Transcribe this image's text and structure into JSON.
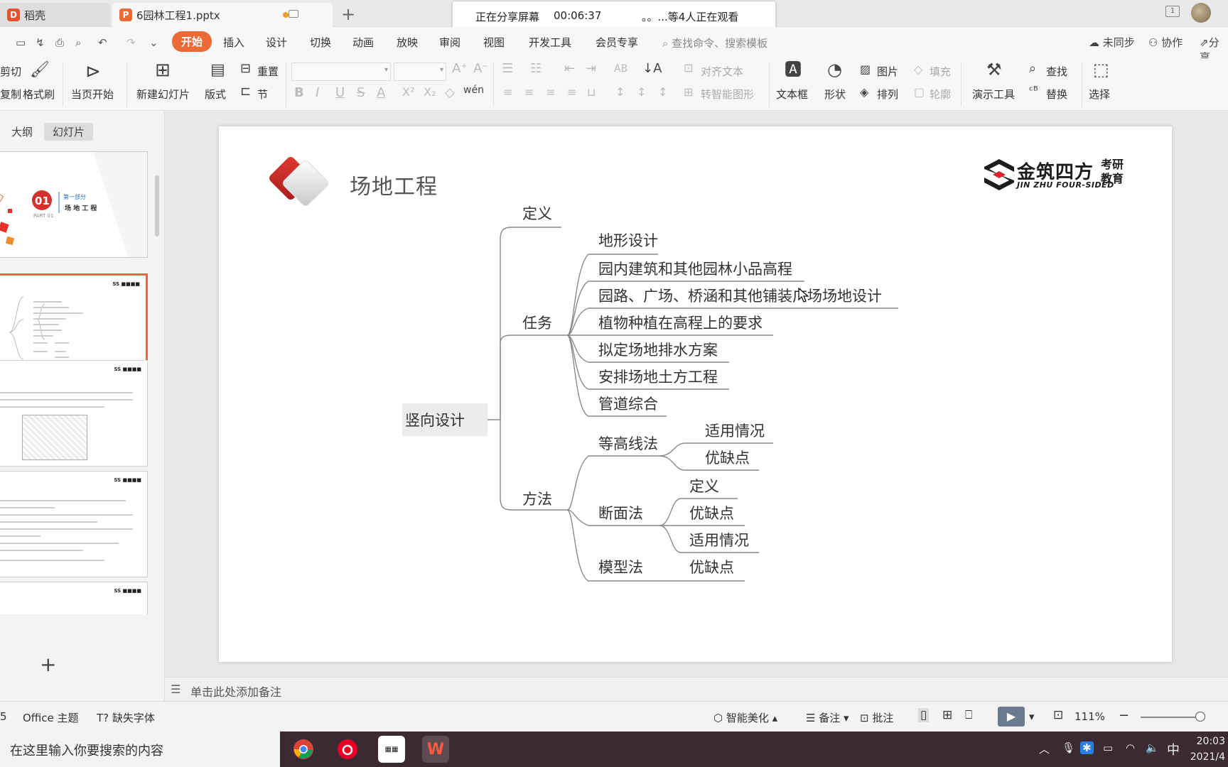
{
  "tabs": {
    "home_label": "稻壳",
    "doc_label": "6园林工程1.pptx",
    "home_logo_color": "#e8512b",
    "doc_logo_color": "#ec6a36"
  },
  "share_banner": {
    "status": "正在分享屏幕",
    "timer": "00:06:37",
    "viewers": "。。...等4人正在观看"
  },
  "window": {
    "page_indicator": "1"
  },
  "menubar": {
    "items": [
      "开始",
      "插入",
      "设计",
      "切换",
      "动画",
      "放映",
      "审阅",
      "视图",
      "开发工具",
      "会员专享"
    ],
    "search_placeholder": "查找命令、搜索模板",
    "sync": "未同步",
    "collab": "协作",
    "share": "分享"
  },
  "ribbon": {
    "cut": "剪切",
    "copy": "复制",
    "format_painter": "格式刷",
    "play_current": "当页开始",
    "new_slide": "新建幻灯片",
    "layout": "版式",
    "reset": "重置",
    "section": "节",
    "align_text": "对齐文本",
    "smart_shape": "转智能图形",
    "textbox": "文本框",
    "shape": "形状",
    "picture": "图片",
    "arrange": "排列",
    "fill": "填充",
    "outline": "轮廓",
    "present_tools": "演示工具",
    "find": "查找",
    "replace": "替换",
    "select": "选择"
  },
  "leftpanel": {
    "tab_outline": "大纲",
    "tab_slides": "幻灯片",
    "thumb1_number": "01",
    "thumb1_part": "PART 01",
    "thumb1_section": "第一部分",
    "thumb1_title": "场 地 工 程"
  },
  "slide": {
    "title": "场地工程",
    "brand_cn": "金筑四方",
    "brand_sub": "考研 教育",
    "brand_en": "JIN ZHU FOUR-SIDED",
    "mindmap": {
      "root": "竖向设计",
      "definition": "定义",
      "tasks": "任务",
      "task_items": [
        "地形设计",
        "园内建筑和其他园林小品高程",
        "园路、广场、桥涵和其他铺装广场场地设计",
        "植物种植在高程上的要求",
        "拟定场地排水方案",
        "安排场地土方工程",
        "管道综合"
      ],
      "methods": "方法",
      "contour": "等高线法",
      "contour_items": [
        "适用情况",
        "优缺点"
      ],
      "section": "断面法",
      "section_items": [
        "定义",
        "优缺点",
        "适用情况"
      ],
      "model": "模型法",
      "model_items": [
        "优缺点"
      ]
    }
  },
  "notes_placeholder": "单击此处添加备注",
  "status": {
    "slide_num": "5",
    "theme": "Office 主题",
    "missing_font": "缺失字体",
    "beautify": "智能美化",
    "notes": "备注",
    "comments": "批注",
    "zoom": "111%"
  },
  "taskbar": {
    "search_placeholder": "在这里输入你要搜索的内容",
    "ime": "中",
    "time": "20:03",
    "date": "2021/4"
  }
}
